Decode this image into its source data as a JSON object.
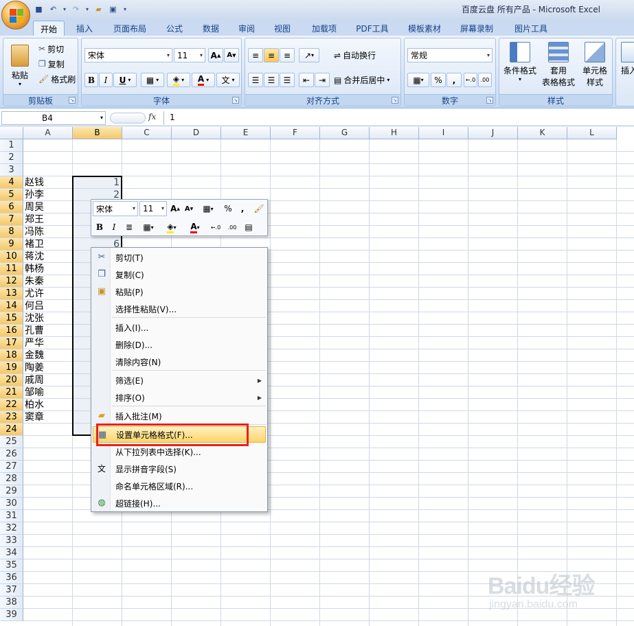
{
  "window_title": "百度云盘 所有产品 - Microsoft Excel",
  "tabs": [
    "开始",
    "插入",
    "页面布局",
    "公式",
    "数据",
    "审阅",
    "视图",
    "加载项",
    "PDF工具",
    "模板素材",
    "屏幕录制",
    "图片工具"
  ],
  "ribbon": {
    "clipboard": {
      "label": "剪贴板",
      "paste": "粘贴",
      "cut": "剪切",
      "copy": "复制",
      "format_painter": "格式刷"
    },
    "font": {
      "label": "字体",
      "font_name": "宋体",
      "font_size": "11",
      "bold": "B",
      "italic": "I",
      "underline": "U",
      "phonetic": "文"
    },
    "alignment": {
      "label": "对齐方式",
      "wrap_text": "自动换行",
      "merge_center": "合并后居中"
    },
    "number": {
      "label": "数字",
      "format": "常规",
      "percent": "%",
      "comma": ","
    },
    "styles": {
      "label": "样式",
      "conditional_format": "条件格式",
      "table_format_1": "套用",
      "table_format_2": "表格格式",
      "cell_style_1": "单元格",
      "cell_style_2": "样式"
    },
    "cells": {
      "insert": "插入"
    }
  },
  "formula_bar": {
    "name_box": "B4",
    "fx": "fx",
    "value": "1"
  },
  "columns": [
    "A",
    "B",
    "C",
    "D",
    "E",
    "F",
    "G",
    "H",
    "I",
    "J",
    "K",
    "L"
  ],
  "rows": [
    "1",
    "2",
    "3",
    "4",
    "5",
    "6",
    "7",
    "8",
    "9",
    "10",
    "11",
    "12",
    "13",
    "14",
    "15",
    "16",
    "17",
    "18",
    "19",
    "20",
    "21",
    "22",
    "23",
    "24",
    "25",
    "26",
    "27",
    "28",
    "29",
    "30",
    "31",
    "32",
    "33",
    "34",
    "35",
    "36",
    "37",
    "38",
    "39"
  ],
  "names": [
    "赵钱",
    "孙李",
    "周吴",
    "郑王",
    "冯陈",
    "褚卫",
    "蒋沈",
    "韩杨",
    "朱秦",
    "尤许",
    "何吕",
    "沈张",
    "孔曹",
    "严华",
    "金魏",
    "陶姜",
    "戚周",
    "邹喻",
    "柏水",
    "窦章"
  ],
  "b_values": {
    "b4": "1",
    "b5": "2",
    "b9": "6"
  },
  "mini_toolbar": {
    "font": "宋体",
    "size": "11",
    "percent": "%",
    "comma": ",",
    "bold": "B",
    "italic": "I"
  },
  "context_menu": [
    {
      "label": "剪切(T)",
      "icon": "scissors-icon"
    },
    {
      "label": "复制(C)",
      "icon": "copy-icon"
    },
    {
      "label": "粘贴(P)",
      "icon": "paste-icon"
    },
    {
      "label": "选择性粘贴(V)...",
      "icon": ""
    },
    {
      "label": "插入(I)...",
      "icon": ""
    },
    {
      "label": "删除(D)...",
      "icon": ""
    },
    {
      "label": "清除内容(N)",
      "icon": ""
    },
    {
      "label": "筛选(E)",
      "icon": ""
    },
    {
      "label": "排序(O)",
      "icon": ""
    },
    {
      "label": "插入批注(M)",
      "icon": "comment-icon"
    },
    {
      "label": "设置单元格格式(F)...",
      "icon": "format-cells-icon"
    },
    {
      "label": "从下拉列表中选择(K)...",
      "icon": ""
    },
    {
      "label": "显示拼音字段(S)",
      "icon": "phonetic-icon"
    },
    {
      "label": "命名单元格区域(R)...",
      "icon": ""
    },
    {
      "label": "超链接(H)...",
      "icon": "hyperlink-icon"
    }
  ],
  "watermark": {
    "brand": "Baidu经验",
    "url": "jingyan.baidu.com"
  }
}
